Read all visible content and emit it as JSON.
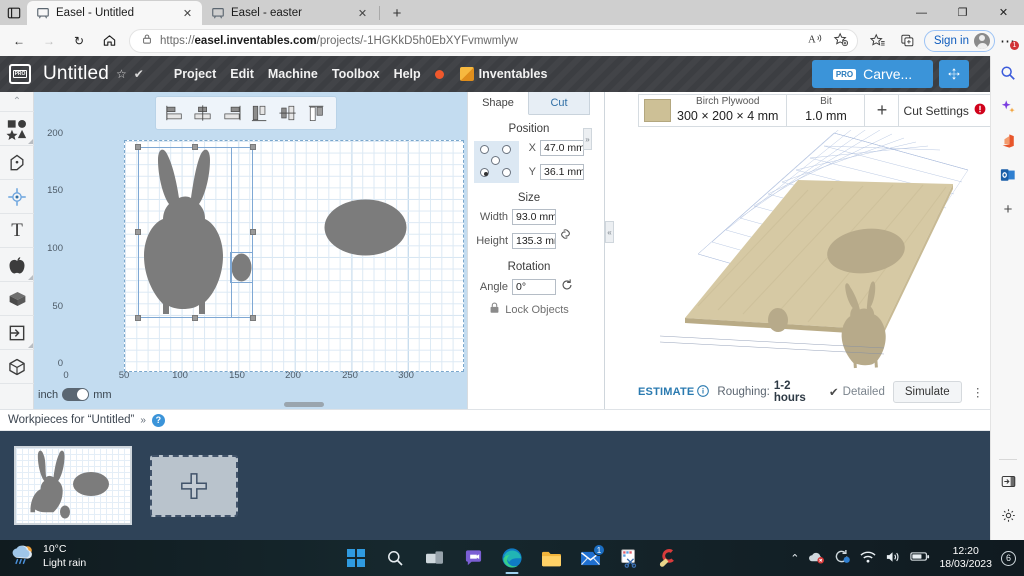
{
  "browser": {
    "tabs": [
      {
        "title": "Easel - Untitled",
        "favicon": "easel-favicon",
        "active": true,
        "close": "✕"
      },
      {
        "title": "Easel - easter",
        "favicon": "easel-favicon",
        "active": false,
        "close": "✕"
      }
    ],
    "new_tab_label": "+",
    "tab_list_icon": "tab-list-icon",
    "window_controls": {
      "minimize": "—",
      "maximize": "❐",
      "close": "✕"
    },
    "nav": {
      "back": "←",
      "forward": "→",
      "reload": "↻",
      "home": "⌂"
    },
    "omnibox": {
      "lock_icon": "lock-icon",
      "url_prefix": "https://",
      "url_domain": "easel.inventables.com",
      "url_path": "/projects/-1HGKkD5h0EbXYFvmwmlyw",
      "read_aloud_icon": "read-aloud-icon",
      "favorite_icon": "add-favorite-icon"
    },
    "collections_icon": "favorites-icon",
    "split_icon": "browser-essentials-icon",
    "sign_in_label": "Sign in",
    "settings_more_label": "⋯",
    "settings_badge": "1"
  },
  "easel": {
    "logo": "easel-pro-logo",
    "project_title": "Untitled",
    "star_icon": "☆",
    "saved_icon": "✔",
    "menu": [
      "Project",
      "Edit",
      "Machine",
      "Toolbox",
      "Help"
    ],
    "record_dot": "recording-indicator",
    "inventables_label": "Inventables",
    "carve_button": {
      "pro_badge": "PRO",
      "label": "Carve..."
    },
    "expand_button": "fullscreen-icon"
  },
  "rail": {
    "collapse": "⌃",
    "items": [
      {
        "name": "shapes-tool",
        "glyph": "shapes"
      },
      {
        "name": "pen-tool",
        "glyph": "pen"
      },
      {
        "name": "center-point-tool",
        "glyph": "target"
      },
      {
        "name": "text-tool",
        "glyph": "T"
      },
      {
        "name": "apps-apple-tool",
        "glyph": "apple"
      },
      {
        "name": "box-tool",
        "glyph": "box"
      },
      {
        "name": "import-tool",
        "glyph": "import"
      },
      {
        "name": "threed-tool",
        "glyph": "cube"
      }
    ]
  },
  "canvas": {
    "align_tools": [
      "align-left",
      "align-center-horizontal",
      "align-right",
      "align-top",
      "align-middle-vertical",
      "align-bottom"
    ],
    "ruler_y": [
      "200",
      "150",
      "100",
      "50",
      "0"
    ],
    "ruler_x": [
      "0",
      "50",
      "100",
      "150",
      "200",
      "250",
      "300"
    ],
    "units": {
      "left": "inch",
      "right": "mm",
      "selected": "mm"
    },
    "zoom_controls": {
      "out": "−",
      "in": "+",
      "fit": "⌂"
    },
    "shapes": [
      {
        "name": "bunny-shape",
        "type": "bunny",
        "selected": true
      },
      {
        "name": "tail-shape",
        "type": "ellipse",
        "selected": true
      },
      {
        "name": "egg-shape",
        "type": "ellipse",
        "selected": false
      }
    ]
  },
  "properties": {
    "tabs": [
      {
        "label": "Shape",
        "selected": true
      },
      {
        "label": "Cut",
        "selected": false
      }
    ],
    "position": {
      "title": "Position",
      "x_label": "X",
      "x_value": "47.0 mm",
      "y_label": "Y",
      "y_value": "36.1 mm",
      "anchor_selected": "bottom-left"
    },
    "size": {
      "title": "Size",
      "width_label": "Width",
      "width_value": "93.0 mm",
      "height_label": "Height",
      "height_value": "135.3 mm",
      "link_icon": "link-aspect-icon"
    },
    "rotation": {
      "title": "Rotation",
      "angle_label": "Angle",
      "angle_value": "0°",
      "reset_icon": "reset-rotation-icon"
    },
    "lock": {
      "icon": "lock-icon",
      "label": "Lock Objects"
    },
    "collapse": "»"
  },
  "preview": {
    "material": {
      "swatch_color": "#cdc096",
      "name": "Birch Plywood",
      "dimensions": "300 × 200 × 4 mm"
    },
    "bit": {
      "label": "Bit",
      "value": "1.0 mm"
    },
    "add_button": "+",
    "cut_settings": {
      "label": "Cut Settings",
      "warning_icon": "warning-icon"
    },
    "estimate": {
      "link": "ESTIMATE",
      "info_icon": "info-icon",
      "roughing_label": "Roughing:",
      "roughing_value": "1-2 hours",
      "detailed_check": "✔",
      "detailed_label": "Detailed",
      "simulate_label": "Simulate",
      "more_icon": "⋮"
    },
    "collapse": "«"
  },
  "workpieces": {
    "title": "Workpieces for “Untitled”",
    "chevron": "»",
    "help_icon": "?",
    "cards": [
      {
        "name": "workpiece-thumbnail-1",
        "selected": true
      },
      {
        "name": "workpiece-add",
        "label": "+"
      }
    ]
  },
  "edge_sidebar": {
    "top": [
      "search-icon",
      "copilot-icon",
      "office-icon",
      "outlook-icon",
      "add-icon"
    ],
    "bottom": [
      "sidebar-toggle-icon",
      "gear-icon"
    ]
  },
  "taskbar": {
    "weather": {
      "icon": "rain-cloud-icon",
      "temp": "10°C",
      "condition": "Light rain"
    },
    "apps": [
      {
        "name": "start-button",
        "glyph": "windows"
      },
      {
        "name": "search-taskbar",
        "glyph": "search"
      },
      {
        "name": "task-view",
        "glyph": "taskview"
      },
      {
        "name": "chat-teams",
        "glyph": "chat"
      },
      {
        "name": "microsoft-edge",
        "glyph": "edge",
        "running": true
      },
      {
        "name": "file-explorer",
        "glyph": "folder"
      },
      {
        "name": "mail",
        "glyph": "mail",
        "badge": "1"
      },
      {
        "name": "snipping-tool",
        "glyph": "snip"
      },
      {
        "name": "ccleaner",
        "glyph": "ccleaner"
      }
    ],
    "tray": {
      "chevron": "⌃",
      "icons": [
        "onedrive-icon",
        "update-icon",
        "wifi-icon",
        "volume-icon",
        "battery-icon"
      ],
      "time": "12:20",
      "date": "18/03/2023",
      "notification_count": "6"
    }
  }
}
